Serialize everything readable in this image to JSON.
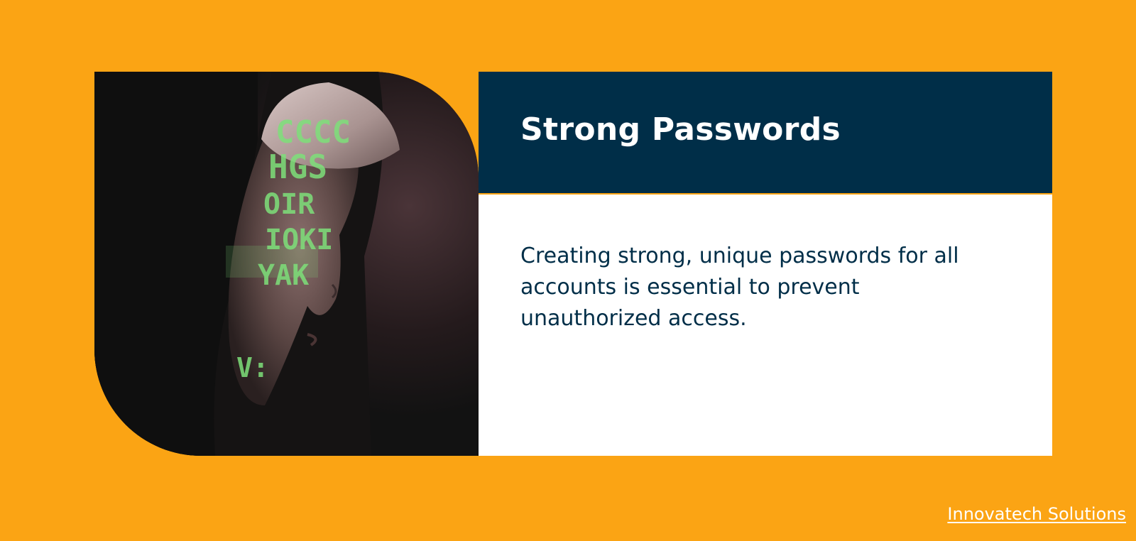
{
  "slide": {
    "title": "Strong Passwords",
    "body": "Creating strong, unique passwords for all accounts is essential to prevent unauthorized access."
  },
  "footer": {
    "link_text": "Innovatech Solutions"
  },
  "photo": {
    "subject": "hooded-person-with-code-projection",
    "projected_text_lines": [
      "CCCC",
      "HGS",
      "OIR",
      "IOKI",
      "YAK",
      "V:"
    ]
  },
  "colors": {
    "background": "#FBA414",
    "title_band": "#002E48",
    "title_text": "#FFFFFF",
    "body_text": "#002E48",
    "code_green": "#7EE07A"
  }
}
